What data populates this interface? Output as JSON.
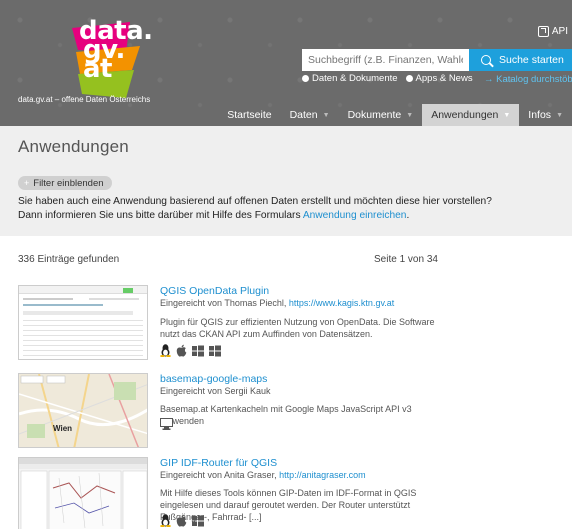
{
  "header": {
    "logo_text": [
      "data.",
      "gv.",
      "at"
    ],
    "tagline": "data.gv.at – offene Daten Österreichs",
    "api_label": "API",
    "search_placeholder": "Suchbegriff (z.B. Finanzen, Wahlen)",
    "search_button": "Suche starten",
    "radio_options": [
      "Daten & Dokumente",
      "Apps & News"
    ],
    "catalog_link": "→ Katalog durchstöbern",
    "colors": {
      "accent": "#1ea0dc",
      "logo_magenta": "#e6007e",
      "logo_orange": "#f39200",
      "logo_green": "#95c11f"
    }
  },
  "nav": {
    "items": [
      {
        "label": "Startseite",
        "dropdown": false,
        "active": false
      },
      {
        "label": "Daten",
        "dropdown": true,
        "active": false
      },
      {
        "label": "Dokumente",
        "dropdown": true,
        "active": false
      },
      {
        "label": "Anwendungen",
        "dropdown": true,
        "active": true
      },
      {
        "label": "Infos",
        "dropdown": true,
        "active": false
      }
    ]
  },
  "page": {
    "title": "Anwendungen",
    "filter_button": "Filter einblenden",
    "intro_line1": "Sie haben auch eine Anwendung basierend auf offenen Daten erstellt und möchten diese hier vorstellen?",
    "intro_line2_prefix": "Dann informieren Sie uns bitte darüber mit Hilfe des Formulars ",
    "intro_link": "Anwendung einreichen",
    "intro_line2_suffix": "."
  },
  "results": {
    "count_text": "336 Einträge gefunden",
    "page_text": "Seite 1 von 34",
    "entries": [
      {
        "title": "QGIS OpenData Plugin",
        "author_prefix": "Eingereicht von Thomas Piechl, ",
        "author_link": "https://www.kagis.ktn.gv.at",
        "description": "Plugin für QGIS zur effizienten Nutzung von OpenData. Die Software nutzt das CKAN API zum Auffinden von Datensätzen.",
        "platforms": [
          "linux-icon",
          "apple-icon",
          "windows-icon",
          "windows-icon"
        ]
      },
      {
        "title": "basemap-google-maps",
        "author_prefix": "Eingereicht von Sergii Kauk",
        "author_link": "",
        "description": "Basemap.at Kartenkacheln mit Google Maps JavaScript API v3 verwenden",
        "platforms": [
          "desktop-icon"
        ]
      },
      {
        "title": "GIP IDF-Router für QGIS",
        "author_prefix": "Eingereicht von Anita Graser, ",
        "author_link": "http://anitagraser.com",
        "description": "Mit Hilfe dieses Tools können GIP-Daten im IDF-Format in QGIS eingelesen und darauf geroutet werden. Der Router unterstützt Fußgänger-, Fahrrad- [...]",
        "platforms": [
          "linux-icon",
          "apple-icon",
          "windows-icon"
        ]
      }
    ],
    "thumb2_label": "Wien"
  }
}
